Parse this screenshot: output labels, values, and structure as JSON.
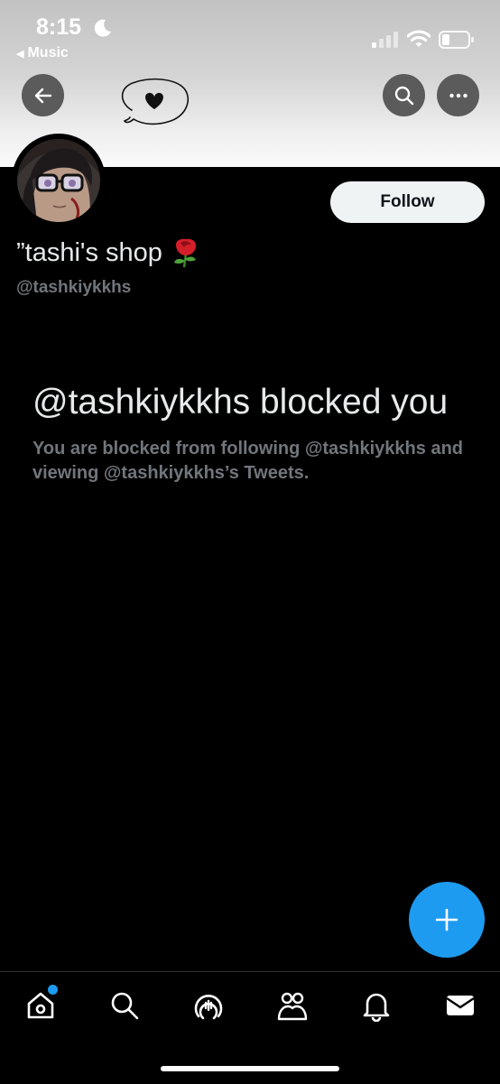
{
  "status_bar": {
    "time": "8:15",
    "back_app": "Music"
  },
  "profile": {
    "display_name": "”tashi's shop",
    "handle": "@tashkiykkhs",
    "follow_label": "Follow"
  },
  "blocked": {
    "title": "@tashkiykkhs blocked you",
    "message": "You are blocked from following @tashkiykkhs and viewing @tashkiykkhs’s Tweets."
  },
  "icons": {
    "header": [
      "back-arrow-icon",
      "heart-doodle-icon",
      "search-icon",
      "more-icon"
    ],
    "tabs": [
      "home-icon",
      "search-icon",
      "spaces-icon",
      "communities-icon",
      "notifications-icon",
      "messages-icon"
    ],
    "compose": "plus-icon"
  },
  "colors": {
    "accent": "#1d9bf0",
    "background": "#000000",
    "secondary_text": "#71767b"
  }
}
